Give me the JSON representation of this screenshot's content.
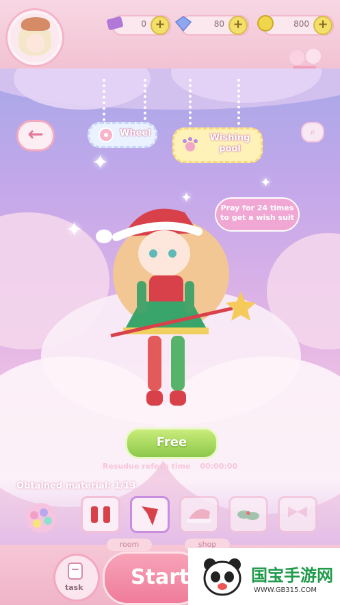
{
  "top_bar": {
    "gems": "0",
    "diamonds": "80",
    "coins": "800",
    "plus_label": "+"
  },
  "scene": {
    "back_label": "←",
    "wheel_label": "Wheel",
    "wishing_pool_label": "Wishing pool",
    "pray_bubble": "Pray for 24 times to get a wish suit",
    "free_button": "Free",
    "refresh_label": "Resudue refesh time",
    "refresh_time": "00:00:00",
    "obtained_label": "Obtained material:",
    "obtained_count": "1/13"
  },
  "bottom_bar": {
    "task_label": "task",
    "start_label": "Start",
    "room_label": "room",
    "shop_label": "shop"
  },
  "watermark": {
    "title": "国宝手游网",
    "url": "WWW.GB315.COM"
  },
  "materials": [
    {
      "name": "socks",
      "selected": false
    },
    {
      "name": "bow-scarf",
      "selected": true
    },
    {
      "name": "santa-hat",
      "selected": false
    },
    {
      "name": "holly",
      "selected": false
    },
    {
      "name": "ribbon-bow",
      "selected": false
    }
  ],
  "colors": {
    "accent_pink": "#f3a9c0",
    "free_green": "#8cc84a",
    "sky_purple": "#a8a8e8"
  }
}
